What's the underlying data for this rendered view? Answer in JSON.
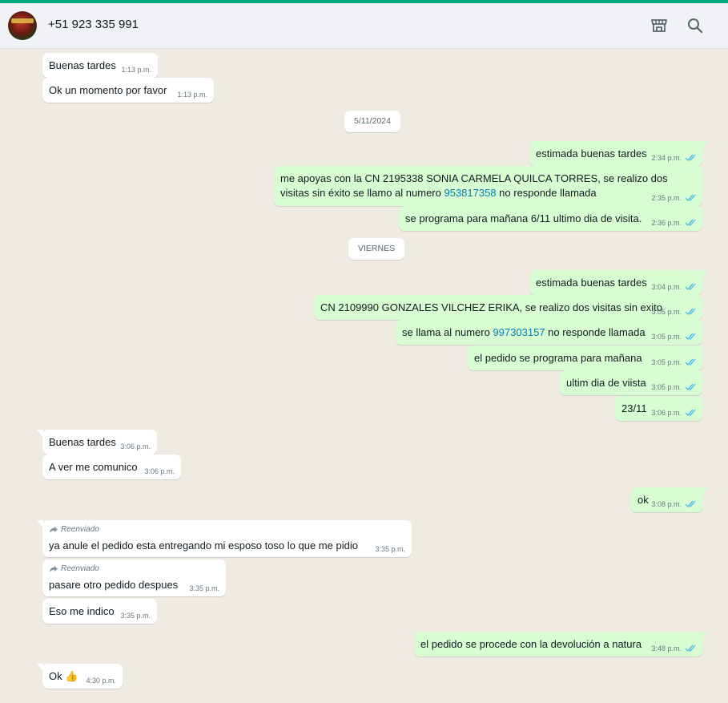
{
  "header": {
    "contact_name": "+51 923 335 991",
    "icons": [
      "avatar",
      "shop-icon",
      "search-icon"
    ]
  },
  "colors": {
    "accent": "#00a884",
    "incoming_bubble": "#ffffff",
    "outgoing_bubble": "#d9fdd3",
    "chat_background": "#efeae2",
    "read_ticks": "#53bdeb",
    "link": "#027eb5"
  },
  "messages": [
    {
      "dir": "in",
      "text": "Buenas tardes",
      "time": "1:13 p.m."
    },
    {
      "dir": "in",
      "text": "Ok un momento por favor",
      "time": "1:13 p.m."
    },
    {
      "type": "date",
      "label": "5/11/2024"
    },
    {
      "dir": "out",
      "text": "estimada buenas tardes",
      "time": "2:34 p.m."
    },
    {
      "dir": "out",
      "text_before": "me apoyas con la CN 2195338 SONIA CARMELA QUILCA TORRES, se realizo dos visitas sin éxito se llamo al numero ",
      "link": "953817358",
      "text_after": " no responde llamada",
      "time": "2:35 p.m."
    },
    {
      "dir": "out",
      "text": "se programa para mañana 6/11 ultimo dia de visita.",
      "time": "2:36 p.m."
    },
    {
      "type": "date",
      "label": "VIERNES"
    },
    {
      "dir": "out",
      "text": "estimada buenas tardes",
      "time": "3:04 p.m."
    },
    {
      "dir": "out",
      "text": "CN 2109990 GONZALES VILCHEZ ERIKA, se realizo dos visitas sin exito",
      "time": "3:05 p.m."
    },
    {
      "dir": "out",
      "text_before": "se llama al numero ",
      "link": "997303157",
      "text_after": " no responde llamada",
      "time": "3:05 p.m."
    },
    {
      "dir": "out",
      "text": "el pedido se programa para mañana",
      "time": "3:05 p.m."
    },
    {
      "dir": "out",
      "text": "ultim dia de viista",
      "time": "3:05 p.m."
    },
    {
      "dir": "out",
      "text": "23/11",
      "time": "3:06 p.m."
    },
    {
      "dir": "in",
      "text": "Buenas tardes",
      "time": "3:06 p.m."
    },
    {
      "dir": "in",
      "text": "A ver me comunico",
      "time": "3:06 p.m."
    },
    {
      "dir": "out",
      "text": "ok",
      "time": "3:08 p.m."
    },
    {
      "dir": "in",
      "forwarded": "Reenviado",
      "text": "ya anule el pedido esta entregando mi esposo toso lo que me pidio",
      "time": "3:35 p.m."
    },
    {
      "dir": "in",
      "forwarded": "Reenviado",
      "text": "pasare otro pedido despues",
      "time": "3:35 p.m."
    },
    {
      "dir": "in",
      "text": "Eso me indico",
      "time": "3:35 p.m."
    },
    {
      "dir": "out",
      "text": "el pedido se procede con la devolución a natura",
      "time": "3:48 p.m."
    },
    {
      "dir": "in",
      "text": "Ok",
      "emoji": "👍",
      "time": "4:30 p.m."
    }
  ]
}
